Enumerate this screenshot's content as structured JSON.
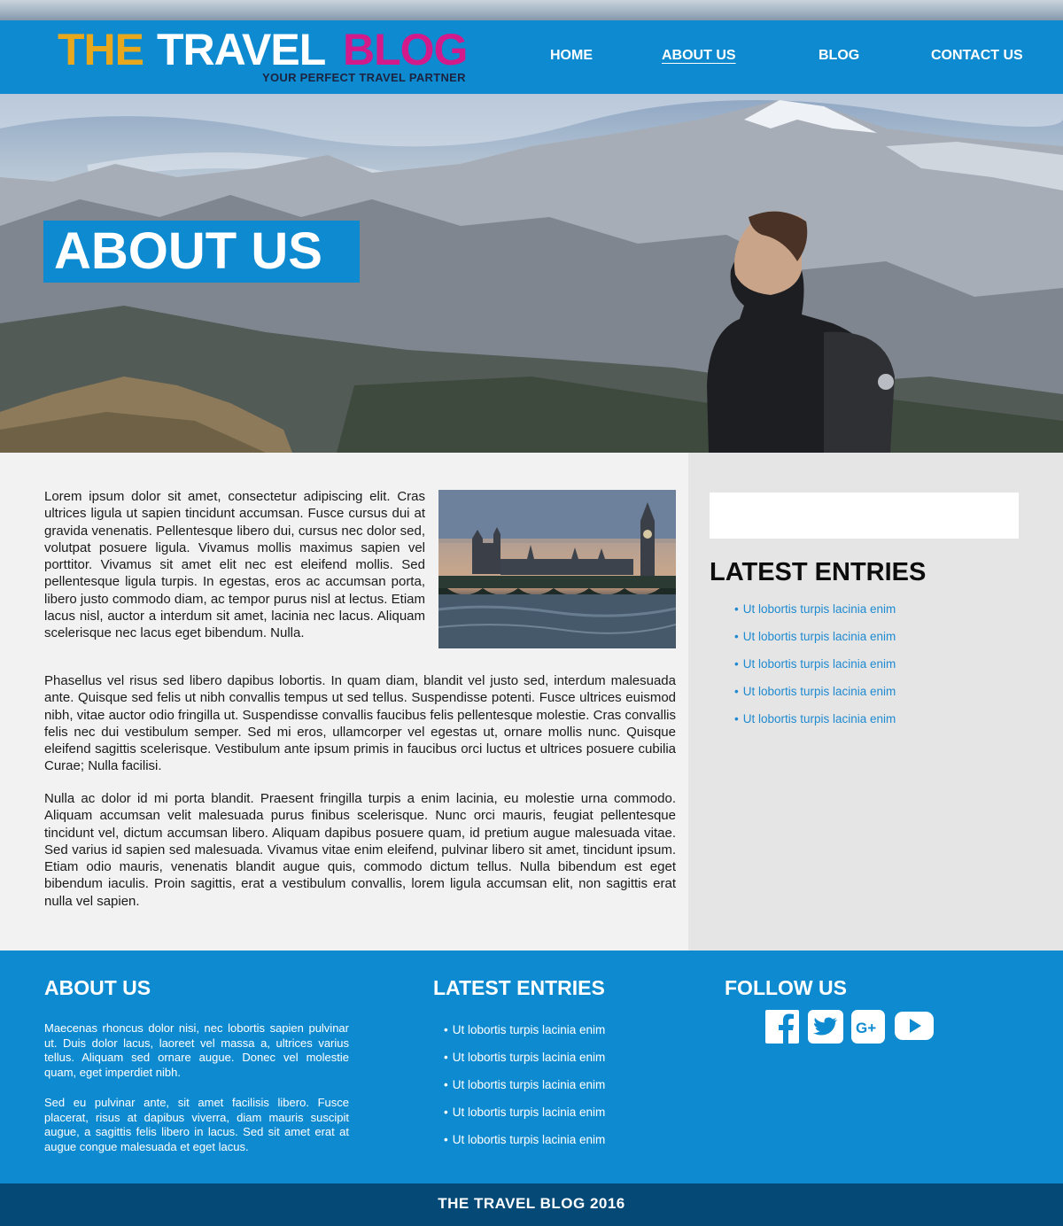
{
  "header": {
    "logo": {
      "the": "THE",
      "travel": "TRAVEL",
      "blog": "BLOG",
      "tagline": "YOUR PERFECT TRAVEL PARTNER"
    },
    "nav": [
      {
        "label": "HOME",
        "active": false
      },
      {
        "label": "ABOUT US",
        "active": true
      },
      {
        "label": "BLOG",
        "active": false
      },
      {
        "label": "CONTACT US",
        "active": false
      }
    ]
  },
  "hero": {
    "title": "ABOUT US"
  },
  "content": {
    "paragraphs": [
      "Lorem ipsum dolor sit amet, consectetur adipiscing elit. Cras ultrices ligula ut sapien tincidunt accumsan. Fusce cursus dui at gravida venenatis. Pellentesque libero dui, cursus nec dolor sed, volutpat posuere ligula. Vivamus mollis maximus sapien vel porttitor. Vivamus sit amet elit nec est eleifend mollis. Sed pellentesque ligula turpis. In egestas, eros ac accumsan porta, libero justo commodo diam, ac tempor purus nisl at lectus. Etiam lacus nisl, auctor a interdum sit amet, lacinia nec lacus. Aliquam scelerisque nec lacus eget bibendum. Nulla.",
      "Phasellus vel risus sed libero dapibus lobortis. In quam diam, blandit vel justo sed, interdum malesuada ante. Quisque sed felis ut nibh convallis tempus ut sed tellus. Suspendisse potenti. Fusce ultrices euismod nibh, vitae auctor odio fringilla ut. Suspendisse convallis faucibus felis pellentesque molestie. Cras convallis felis nec dui vestibulum semper. Sed mi eros, ullamcorper vel egestas ut, ornare mollis nunc. Quisque eleifend sagittis scelerisque. Vestibulum ante ipsum primis in faucibus orci luctus et ultrices posuere cubilia Curae; Nulla facilisi.",
      "Nulla ac dolor id mi porta blandit. Praesent fringilla turpis a enim lacinia, eu molestie urna commodo. Aliquam accumsan velit malesuada purus finibus scelerisque. Nunc orci mauris, feugiat pellentesque tincidunt vel, dictum accumsan libero. Aliquam dapibus posuere quam, id pretium augue malesuada vitae. Sed varius id sapien sed malesuada. Vivamus vitae enim eleifend, pulvinar libero sit amet, tincidunt ipsum. Etiam odio mauris, venenatis blandit augue quis, commodo dictum tellus. Nulla bibendum est eget bibendum iaculis. Proin sagittis, erat a vestibulum convallis, lorem ligula accumsan elit, non sagittis erat nulla vel sapien."
    ]
  },
  "sidebar": {
    "search_value": "",
    "title": "LATEST ENTRIES",
    "entries": [
      "Ut lobortis turpis lacinia enim",
      "Ut lobortis turpis lacinia enim",
      "Ut lobortis turpis lacinia enim",
      "Ut lobortis turpis lacinia enim",
      "Ut lobortis turpis lacinia enim"
    ]
  },
  "footer": {
    "about": {
      "title": "ABOUT US",
      "paragraphs": [
        "Maecenas rhoncus dolor nisi, nec lobortis sapien pulvinar ut. Duis dolor lacus, laoreet vel massa a, ultrices varius tellus. Aliquam sed ornare augue. Donec vel molestie quam, eget imperdiet nibh.",
        "Sed eu pulvinar ante, sit amet facilisis libero. Fusce placerat, risus at dapibus viverra, diam mauris suscipit augue, a sagittis felis libero in lacus. Sed sit amet erat at augue congue malesuada et eget lacus."
      ]
    },
    "latest": {
      "title": "LATEST ENTRIES",
      "entries": [
        "Ut lobortis turpis lacinia enim",
        "Ut lobortis turpis lacinia enim",
        "Ut lobortis turpis lacinia enim",
        "Ut lobortis turpis lacinia enim",
        "Ut lobortis turpis lacinia enim"
      ]
    },
    "follow": {
      "title": "FOLLOW US",
      "icons": [
        "facebook-icon",
        "twitter-icon",
        "google-plus-icon",
        "youtube-icon"
      ]
    },
    "copyright": "THE TRAVEL BLOG 2016"
  },
  "colors": {
    "primary_blue": "#0e8bd0",
    "dark_blue": "#054a77",
    "logo_the": "#e8a81e",
    "logo_blog": "#d21a8a",
    "link_blue": "#1f8ad0"
  }
}
